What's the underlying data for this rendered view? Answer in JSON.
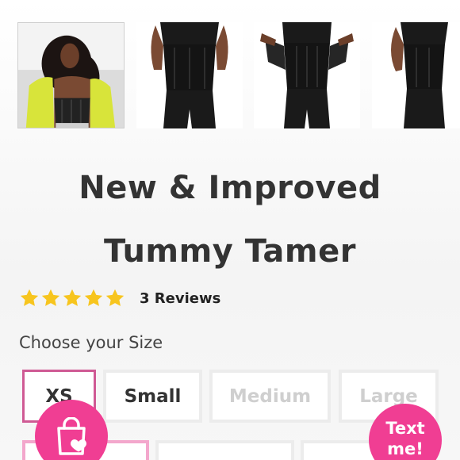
{
  "product": {
    "title_line_1": "New & Improved",
    "title_line_2": "Tummy Tamer",
    "rating": {
      "stars": 5,
      "reviews_label": "3 Reviews"
    },
    "gallery": [
      {
        "name": "model-front-yellow-jacket"
      },
      {
        "name": "waist-trainer-front"
      },
      {
        "name": "waist-trainer-open"
      },
      {
        "name": "waist-trainer-side"
      }
    ]
  },
  "size_selector": {
    "label": "Choose your Size",
    "options": [
      {
        "label": "XS",
        "state": "selected"
      },
      {
        "label": "Small",
        "state": "available"
      },
      {
        "label": "Medium",
        "state": "unavailable"
      },
      {
        "label": "Large",
        "state": "unavailable"
      }
    ]
  },
  "actions": {
    "cart_icon": "shopping-bag-heart-icon",
    "text_me_label": "Text\nme!"
  },
  "colors": {
    "accent_pink": "#f03e93",
    "selected_border": "#cf5a94",
    "star_yellow": "#f7c51e",
    "title_text": "#333333"
  }
}
